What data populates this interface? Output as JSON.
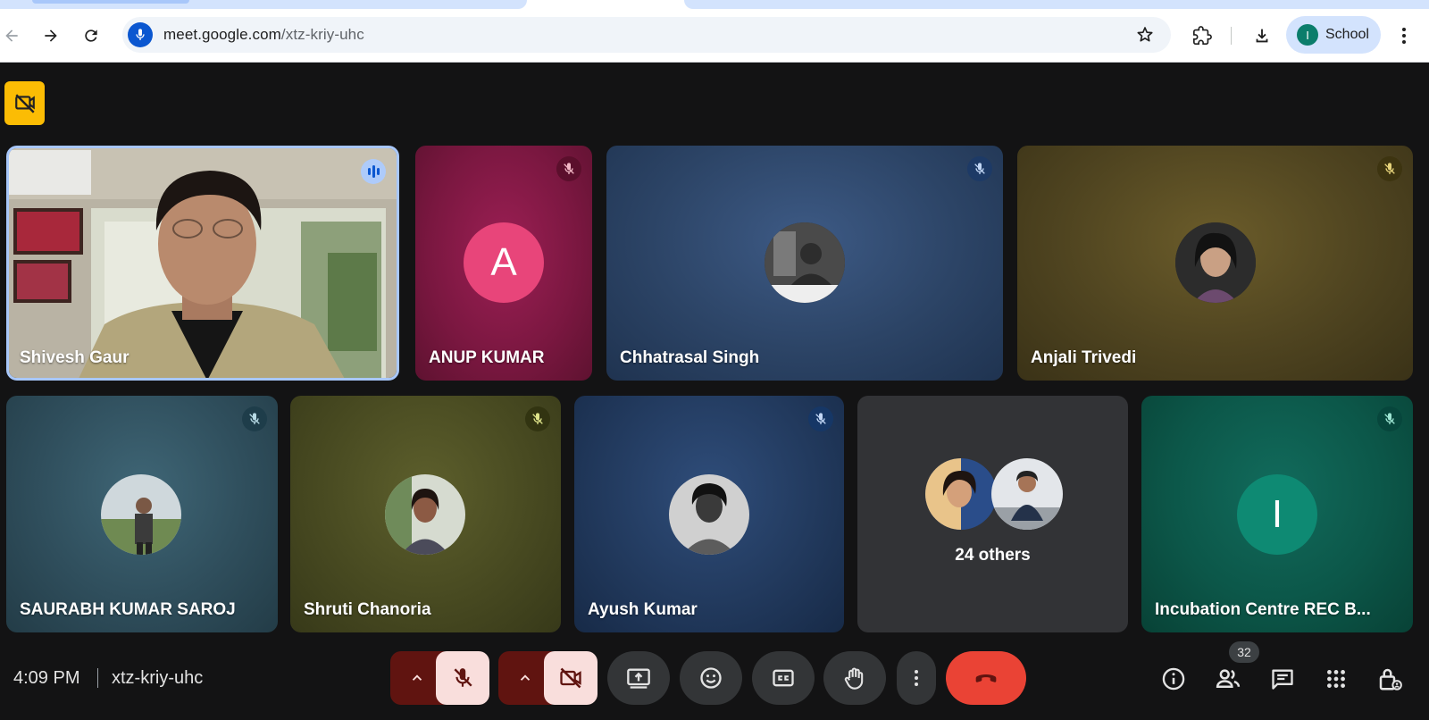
{
  "browser": {
    "url_host": "meet.google.com",
    "url_path": "/xtz-kriy-uhc",
    "profile_initial": "I",
    "profile_label": "School"
  },
  "tiles": [
    {
      "name": "Shivesh Gaur",
      "state": "speaking"
    },
    {
      "name": "ANUP KUMAR",
      "avatar_letter": "A",
      "muted": true
    },
    {
      "name": "Chhatrasal Singh",
      "muted": true
    },
    {
      "name": "Anjali Trivedi",
      "muted": true
    },
    {
      "name": "SAURABH KUMAR SAROJ",
      "muted": true
    },
    {
      "name": "Shruti Chanoria",
      "muted": true
    },
    {
      "name": "Ayush Kumar",
      "muted": true
    },
    {
      "label": "24 others"
    },
    {
      "name": "Incubation Centre REC B...",
      "avatar_letter": "I",
      "muted": true
    }
  ],
  "meeting": {
    "time": "4:09 PM",
    "code": "xtz-kriy-uhc",
    "participant_count": "32"
  },
  "colors": {
    "accent": "#0b57d0",
    "end_call": "#ea4335",
    "muted_control_bg": "#f9dedc",
    "muted_control_chevron_bg": "#601410",
    "cam_off_badge": "#fbbc04"
  }
}
